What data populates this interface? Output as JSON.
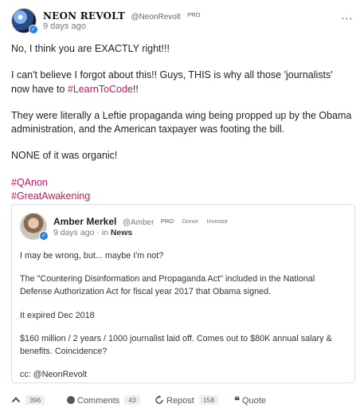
{
  "post": {
    "author_name": "NEON REVOLT",
    "author_handle": "@NeonRevolt",
    "author_badge": "PRO",
    "time": "9 days ago",
    "paragraphs": {
      "p1": "No, I think you are EXACTLY right!!!",
      "p2_before": "I can't believe I forgot about this!! Guys, THIS is why all those 'journalists' now have to ",
      "p2_link": "#LearnToCode",
      "p2_after": "!!",
      "p3": "They were literally a Leftie propaganda wing being propped up by the Obama administration, and the American taxpayer was footing the bill.",
      "p4": "NONE of it was organic!"
    },
    "hashtags": [
      "#QAnon",
      "#GreatAwakening"
    ]
  },
  "quoted": {
    "author_name": "Amber Merkel",
    "author_handle": "@Amber",
    "badges": [
      "PRO",
      "Donor",
      "Investor"
    ],
    "time": "9 days ago",
    "in_label": "· in",
    "group": "News",
    "paragraphs": [
      "I may be wrong, but... maybe I'm not?",
      "The \"Countering Disinformation and Propaganda Act\" included in the National Defense Authorization Act for fiscal year 2017 that Obama signed.",
      "It expired Dec 2018",
      "$160 million / 2 years / 1000 journalist laid off. Comes out to $80K annual salary & benefits. Coincidence?",
      "cc: @NeonRevolt"
    ]
  },
  "actions": {
    "upvote_count": "396",
    "comments_label": "Comments",
    "comments_count": "43",
    "repost_label": "Repost",
    "repost_count": "158",
    "quote_label": "Quote"
  },
  "icons": {
    "more": "more-dots-icon",
    "verified": "verified-check-icon",
    "upvote": "chevron-up-icon",
    "comments": "speech-bubble-icon",
    "repost": "repost-arrows-icon",
    "quote": "quote-icon"
  },
  "colors": {
    "hashtag": "#c2185b",
    "verified": "#2b7de1"
  }
}
